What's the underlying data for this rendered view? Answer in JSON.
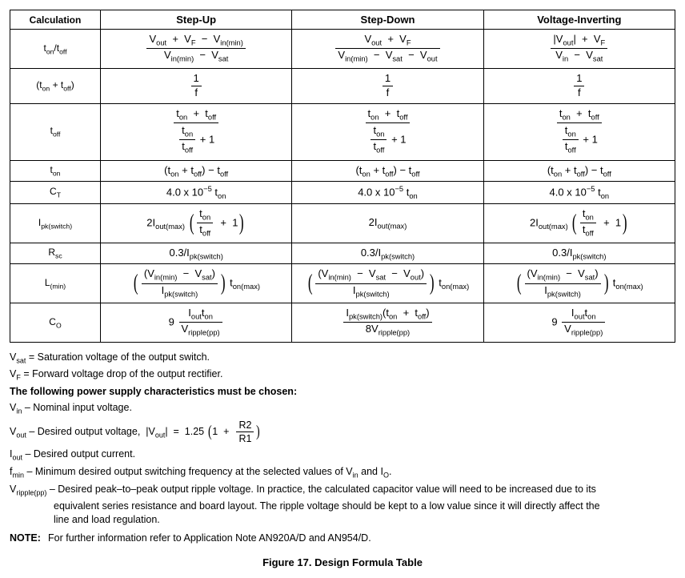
{
  "table": {
    "headers": [
      "Calculation",
      "Step-Up",
      "Step-Down",
      "Voltage-Inverting"
    ],
    "rows": {
      "r1_calc_html": "t<span class='sub'>on</span>/t<span class='sub'>off</span>",
      "r2_calc_html": "(t<span class='sub'>on</span> + t<span class='sub'>off</span>)",
      "r3_calc_html": "t<span class='sub'>off</span>",
      "r4_calc_html": "t<span class='sub'>on</span>",
      "r5_calc_html": "C<span class='sub'>T</span>",
      "r6_calc_html": "I<span class='sub'>pk(switch)</span>",
      "r7_calc_html": "R<span class='sub'>sc</span>",
      "r8_calc_html": "L<span class='sub'>(min)</span>",
      "r9_calc_html": "C<span class='sub'>O</span>",
      "r1_su_html": "<span class='frac'><span class='num'>V<span class='sub'>out</span> &nbsp;+&nbsp; V<span class='sub'>F</span> &nbsp;&minus;&nbsp; V<span class='sub'>in(min)</span></span><span class='den'>V<span class='sub'>in(min)</span> &nbsp;&minus;&nbsp; V<span class='sub'>sat</span></span></span>",
      "r1_sd_html": "<span class='frac'><span class='num'>V<span class='sub'>out</span> &nbsp;+&nbsp; V<span class='sub'>F</span></span><span class='den'>V<span class='sub'>in(min)</span> &nbsp;&minus;&nbsp; V<span class='sub'>sat</span> &nbsp;&minus;&nbsp; V<span class='sub'>out</span></span></span>",
      "r1_vi_html": "<span class='frac'><span class='num'>|V<span class='sub'>out</span>| &nbsp;+&nbsp; V<span class='sub'>F</span></span><span class='den'>V<span class='sub'>in</span> &nbsp;&minus;&nbsp; V<span class='sub'>sat</span></span></span>",
      "r2_all_html": "<span class='frac'><span class='num'>1</span><span class='den'>f</span></span>",
      "r3_all_html": "<span class='frac'><span class='num'>t<span class='sub'>on</span> &nbsp;+&nbsp; t<span class='sub'>off</span></span><span class='den'><span class='frac'><span class='num'>t<span class='sub'>on</span></span><span class='den'>t<span class='sub'>off</span></span></span> + 1</span></span>",
      "r4_all_html": "(t<span class='sub'>on</span> + t<span class='sub'>off</span>) &minus; t<span class='sub'>off</span>",
      "r5_all_html": "4.0 x 10<span class='sup'>&minus;5</span> t<span class='sub'>on</span>",
      "r6_su_html": "2I<span class='sub'>out(max)</span> <span class='paren-group'><span class='big-paren'>(</span><span class='frac'><span class='num'>t<span class='sub'>on</span></span><span class='den'>t<span class='sub'>off</span></span></span> &nbsp;+&nbsp; 1<span class='big-paren'>)</span></span>",
      "r6_sd_html": "2I<span class='sub'>out(max)</span>",
      "r6_vi_html": "2I<span class='sub'>out(max)</span> <span class='paren-group'><span class='big-paren'>(</span><span class='frac'><span class='num'>t<span class='sub'>on</span></span><span class='den'>t<span class='sub'>off</span></span></span> &nbsp;+&nbsp; 1<span class='big-paren'>)</span></span>",
      "r7_all_html": "0.3/I<span class='sub'>pk(switch)</span>",
      "r8_su_html": "<span class='paren-group'><span class='big-paren'>(</span><span class='frac'><span class='num'>(V<span class='sub'>in(min)</span> &nbsp;&minus;&nbsp; V<span class='sub'>sat</span>)</span><span class='den'>I<span class='sub'>pk(switch)</span></span></span><span class='big-paren'>)</span></span> t<span class='sub'>on(max)</span>",
      "r8_sd_html": "<span class='paren-group'><span class='big-paren'>(</span><span class='frac'><span class='num'>(V<span class='sub'>in(min)</span> &nbsp;&minus;&nbsp; V<span class='sub'>sat</span> &nbsp;&minus;&nbsp; V<span class='sub'>out</span>)</span><span class='den'>I<span class='sub'>pk(switch)</span></span></span><span class='big-paren'>)</span></span> t<span class='sub'>on(max)</span>",
      "r8_vi_html": "<span class='paren-group'><span class='big-paren'>(</span><span class='frac'><span class='num'>(V<span class='sub'>in(min)</span> &nbsp;&minus;&nbsp; V<span class='sub'>sat</span>)</span><span class='den'>I<span class='sub'>pk(switch)</span></span></span><span class='big-paren'>)</span></span> t<span class='sub'>on(max)</span>",
      "r9_su_html": "9 <span class='frac'><span class='num'>I<span class='sub'>out</span>t<span class='sub'>on</span></span><span class='den'>V<span class='sub'>ripple(pp)</span></span></span>",
      "r9_sd_html": "<span class='frac'><span class='num'>I<span class='sub'>pk(switch)</span>(t<span class='sub'>on</span> &nbsp;+&nbsp; t<span class='sub'>off</span>)</span><span class='den'>8V<span class='sub'>ripple(pp)</span></span></span>",
      "r9_vi_html": "9 <span class='frac'><span class='num'>I<span class='sub'>out</span>t<span class='sub'>on</span></span><span class='den'>V<span class='sub'>ripple(pp)</span></span></span>"
    }
  },
  "notes": {
    "vsat_html": "V<span class='sub'>sat</span> = Saturation voltage of the output switch.",
    "vf_html": "V<span class='sub'>F</span> = Forward voltage drop of the output rectifier.",
    "heading": "The following power supply characteristics must be chosen:",
    "vin_html": "V<span class='sub'>in</span> &ndash; Nominal input voltage.",
    "vout_html": "V<span class='sub'>out</span> &ndash; Desired output voltage, &nbsp;|V<span class='sub'>out</span>|&nbsp; = &nbsp;1.25 <span class='paren-group'><span class='small-paren'>(</span>1 &nbsp;+&nbsp; <span class='frac'><span class='num'>R2</span><span class='den'>R1</span></span><span class='small-paren'>)</span></span>",
    "iout_html": "I<span class='sub'>out</span> &ndash; Desired output current.",
    "fmin_html": "f<span class='sub'>min</span> &ndash; Minimum desired output switching frequency at the selected values of V<span class='sub'>in</span> and I<span class='sub'>O</span>.",
    "vripple_html": "V<span class='sub'>ripple(pp)</span> &ndash; Desired peak&ndash;to&ndash;peak output ripple voltage. In practice, the calculated capacitor value will need to be increased due to its",
    "vripple_cont1": "equivalent series resistance and board layout. The ripple voltage should be kept to a low value since it will directly affect the",
    "vripple_cont2": "line and load regulation.",
    "note_label": "NOTE:",
    "note_text": "For further information refer to Application Note AN920A/D and AN954/D."
  },
  "caption": "Figure 17. Design Formula Table"
}
